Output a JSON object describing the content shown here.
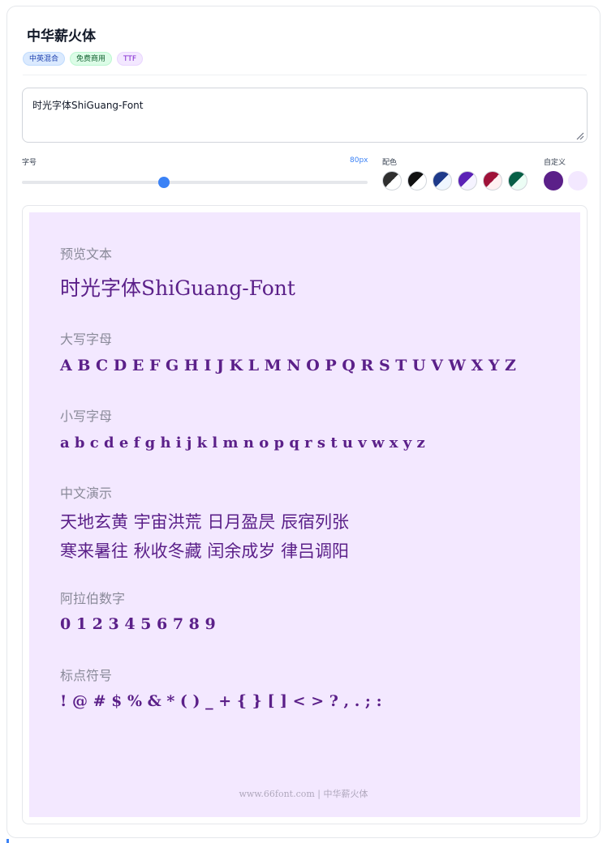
{
  "font": {
    "title": "中华薪火体",
    "tags": [
      "中英混合",
      "免费商用",
      "TTF"
    ]
  },
  "input": {
    "value": "时光字体ShiGuang-Font"
  },
  "controls": {
    "size_label": "字号",
    "size_value": "80px",
    "size_fraction": 0.41,
    "color_label": "配色",
    "custom_label": "自定义",
    "swatches": [
      {
        "fg": "#2f2f2f",
        "bg": "#ffffff"
      },
      {
        "fg": "#111111",
        "bg": "#ffffff"
      },
      {
        "fg": "#1e3a8a",
        "bg": "#eff6ff"
      },
      {
        "fg": "#5b21b6",
        "bg": "#f5f3ff"
      },
      {
        "fg": "#9f1239",
        "bg": "#fff1f2"
      },
      {
        "fg": "#065f46",
        "bg": "#ecfdf5"
      }
    ],
    "custom_colors": {
      "fg": "#5b2089",
      "bg": "#f3e8ff"
    }
  },
  "preview": {
    "sections": [
      {
        "label": "预览文本",
        "lines": [
          "时光字体ShiGuang-Font"
        ]
      },
      {
        "label": "大写字母",
        "lines": [
          "A B C D E F G H I J K L M N O P Q R S T U V W X Y Z"
        ]
      },
      {
        "label": "小写字母",
        "lines": [
          "a b c d e f g h i j k l m n o p q r s t u v w x y z"
        ]
      },
      {
        "label": "中文演示",
        "lines": [
          "天地玄黄 宇宙洪荒 日月盈昃 辰宿列张",
          "寒来暑往 秋收冬藏 闰余成岁 律吕调阳"
        ]
      },
      {
        "label": "阿拉伯数字",
        "lines": [
          "0 1 2 3 4 5 6 7 8 9"
        ]
      },
      {
        "label": "标点符号",
        "lines": [
          "! @ # $ % & * ( ) _ + { } [ ] < > ? , . ; :"
        ]
      }
    ],
    "footer": "www.66font.com | 中华薪火体"
  }
}
